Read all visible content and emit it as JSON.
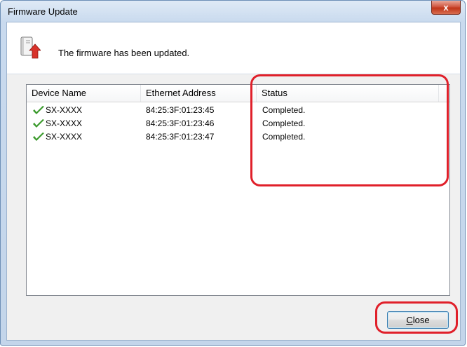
{
  "window": {
    "title": "Firmware Update",
    "close_glyph": "x"
  },
  "header": {
    "message": "The firmware has been updated.",
    "icon": "firmware-update-icon"
  },
  "table": {
    "columns": [
      "Device Name",
      "Ethernet Address",
      "Status"
    ],
    "rows": [
      {
        "device": "SX-XXXX",
        "ethernet": "84:25:3F:01:23:45",
        "status": "Completed.",
        "icon": "check-icon"
      },
      {
        "device": "SX-XXXX",
        "ethernet": "84:25:3F:01:23:46",
        "status": "Completed.",
        "icon": "check-icon"
      },
      {
        "device": "SX-XXXX",
        "ethernet": "84:25:3F:01:23:47",
        "status": "Completed.",
        "icon": "check-icon"
      }
    ]
  },
  "buttons": {
    "close_mnemonic": "C",
    "close_rest": "lose"
  },
  "colors": {
    "highlight": "#e0202a",
    "check": "#3a9a2c"
  }
}
